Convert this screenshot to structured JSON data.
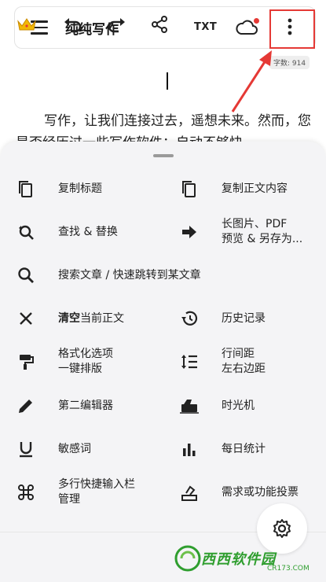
{
  "header": {
    "title": "纯纯写作",
    "txt_label": "TXT",
    "word_count": "字数: 914"
  },
  "document": {
    "text": "写作，让我们连接过去，遥想未来。然而，您是否经历过一些写作软件：自动不够快"
  },
  "menu": {
    "copy_title": "复制标题",
    "copy_body": "复制正文内容",
    "find_replace": "查找 & 替换",
    "long_image_l1": "长图片、PDF",
    "long_image_l2": "预览 & 另存为...",
    "search_articles": "搜索文章 / 快速跳转到某文章",
    "clear_bold": "清空",
    "clear_rest": "当前正文",
    "history": "历史记录",
    "format_l1": "格式化选项",
    "format_l2": "一键排版",
    "spacing_l1": "行间距",
    "spacing_l2": "左右边距",
    "second_editor": "第二编辑器",
    "time_machine": "时光机",
    "sensitive_words": "敏感词",
    "daily_stats": "每日统计",
    "multiline_l1": "多行快捷输入栏",
    "multiline_l2": "管理",
    "feature_vote": "需求或功能投票"
  },
  "watermark": {
    "text": "西西软件园",
    "domain": "CR173.COM"
  },
  "colors": {
    "highlight": "#e53935",
    "sheet_bg": "#f4f4f6",
    "watermark": "#2f9e2f"
  }
}
